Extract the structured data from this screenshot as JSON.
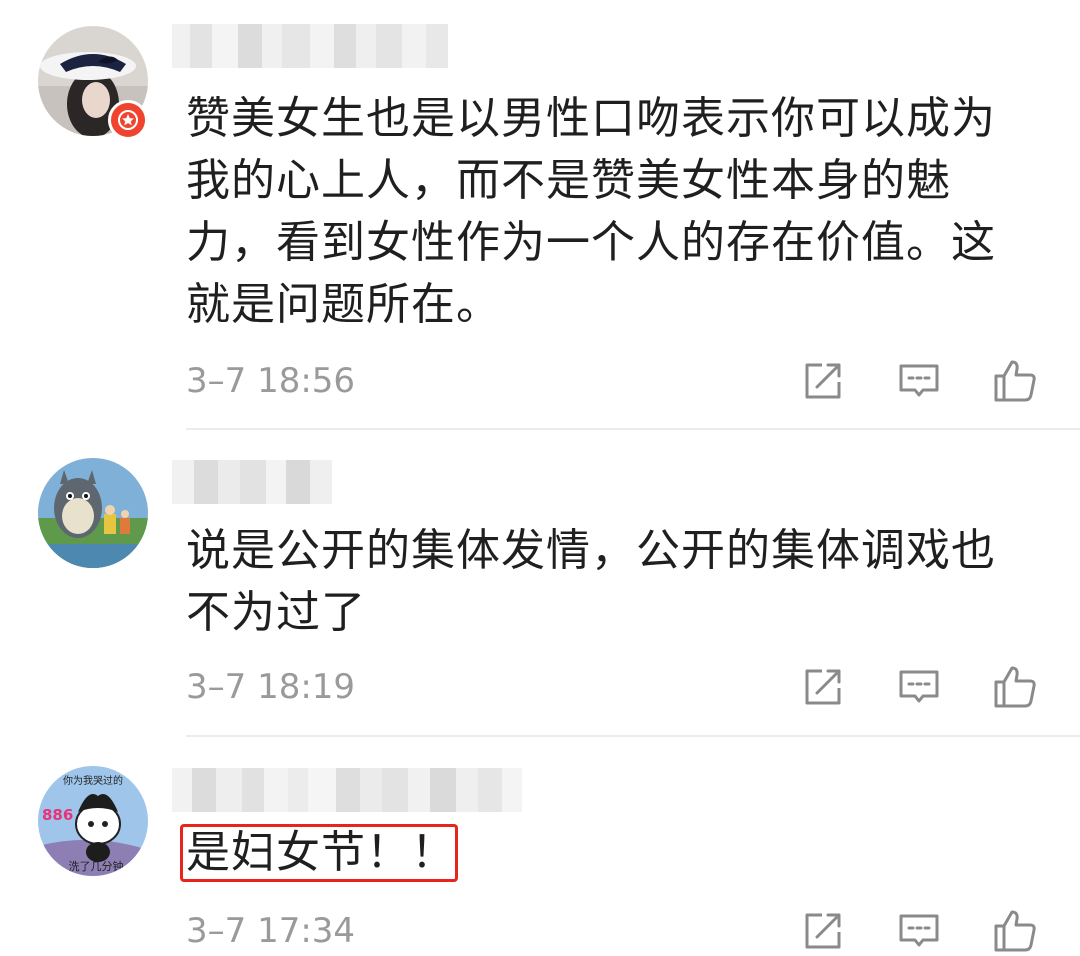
{
  "comments": [
    {
      "text": "赞美女生也是以男性口吻表示你可以成为我的心上人，而不是赞美女性本身的魅力，看到女性作为一个人的存在价值。这就是问题所在。",
      "time": "3–7 18:56",
      "has_vip_badge": true
    },
    {
      "text": "说是公开的集体发情，公开的集体调戏也不为过了",
      "time": "3–7 18:19",
      "has_vip_badge": false
    },
    {
      "text": "是妇女节！！",
      "time": "3–7 17:34",
      "has_vip_badge": false,
      "highlighted": true
    }
  ],
  "third_avatar_text": {
    "top": "你为我哭过的",
    "number": "886",
    "bottom": "洗了几分钟"
  },
  "colors": {
    "highlight_border": "#e8251a",
    "vip_badge": "#f0442e",
    "timestamp": "#9a9a9a",
    "icon_stroke": "#8a8a8a"
  },
  "icons": [
    "share-icon",
    "reply-icon",
    "like-icon"
  ]
}
